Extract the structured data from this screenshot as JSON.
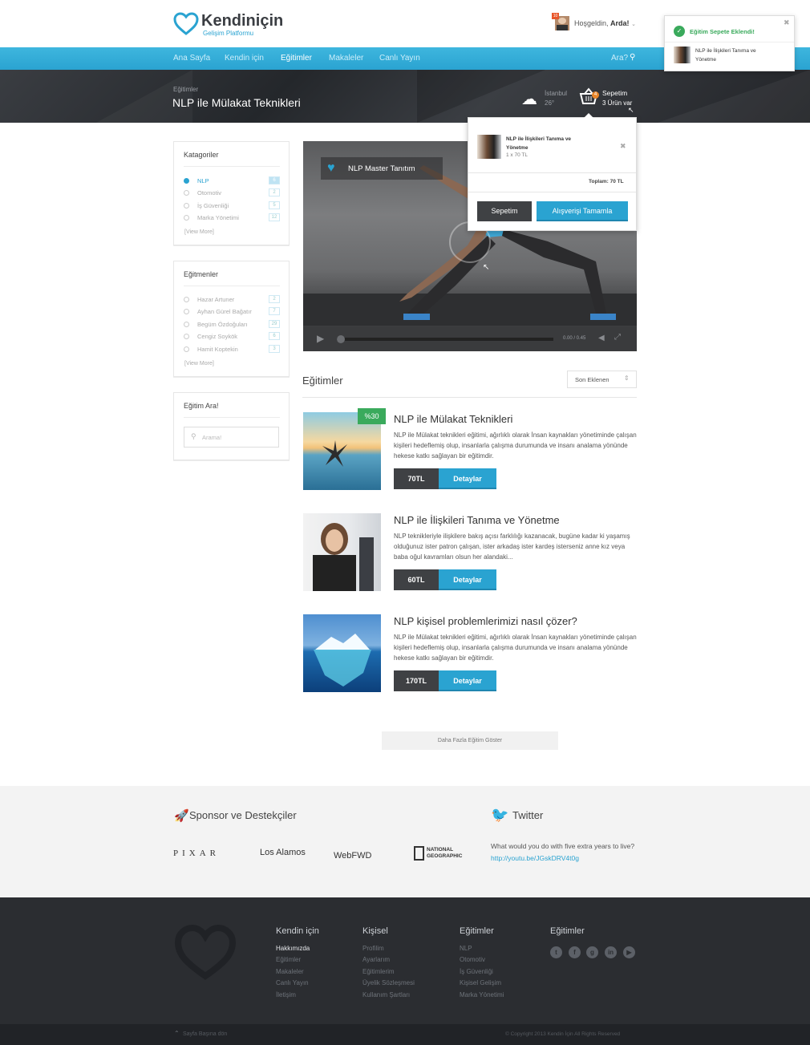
{
  "brand": {
    "name": "Kendiniçin",
    "tagline": "Gelişim Platformu"
  },
  "user": {
    "greeting": "Hoşgeldin,",
    "name": "Arda!",
    "notification_count": "10"
  },
  "nav": {
    "items": [
      "Ana Sayfa",
      "Kendin için",
      "Eğitimler",
      "Makaleler",
      "Canlı Yayın"
    ],
    "active": "Eğitimler",
    "search_label": "Ara?"
  },
  "hero": {
    "breadcrumb": "Eğitimler",
    "title": "NLP ile Mülakat Teknikleri",
    "weather_city": "İstanbul",
    "weather_temp": "26°",
    "cart_label": "Sepetim",
    "cart_count_text": "3 Ürün var",
    "cart_badge": "4"
  },
  "cart_popup": {
    "item_title": "NLP ile İlişkileri Tanıma ve Yönetme",
    "item_qty": "1 x 70 TL",
    "total": "Toplam: 70 TL",
    "cart_button": "Sepetim",
    "checkout_button": "Alışverişi Tamamla"
  },
  "toast": {
    "title": "Eğitim Sepete Eklendi!",
    "item_title": "NLP ile İlişkileri Tanıma ve Yönetme"
  },
  "sidebar": {
    "categories": {
      "title": "Katagoriler",
      "items": [
        {
          "label": "NLP",
          "count": "6"
        },
        {
          "label": "Otomotiv",
          "count": "2"
        },
        {
          "label": "İş Güvenliği",
          "count": "5"
        },
        {
          "label": "Marka Yönetimi",
          "count": "12"
        }
      ],
      "view_more": "[View More]"
    },
    "trainers": {
      "title": "Eğitmenler",
      "items": [
        {
          "label": "Hazar Artuner",
          "count": "2"
        },
        {
          "label": "Ayhan Gürel Bağatır",
          "count": "7"
        },
        {
          "label": "Begüm Özdoğuları",
          "count": "29"
        },
        {
          "label": "Cengiz Soykök",
          "count": "6"
        },
        {
          "label": "Hamit Koptekin",
          "count": "3"
        }
      ],
      "view_more": "[View More]"
    },
    "search": {
      "title": "Eğitim Ara!",
      "placeholder": "Arama!"
    }
  },
  "video": {
    "title": "NLP Master Tanıtım",
    "time": "0.00 / 0.45",
    "progress": 0.0
  },
  "list": {
    "heading": "Eğitimler",
    "sort": "Son Eklenen",
    "more_button": "Daha Fazla Eğitim Göster"
  },
  "courses": [
    {
      "title": "NLP ile Mülakat Teknikleri",
      "desc": "NLP ile Mülakat teknikleri eğitimi, ağırlıklı olarak İnsan kaynakları yönetiminde çalışan kişileri hedeflemiş olup, insanlarla çalışma durumunda ve insanı analama yönünde hekese katkı sağlayan bir eğitimdir.",
      "price": "70TL",
      "button": "Detaylar",
      "discount": "%30"
    },
    {
      "title": "NLP ile İlişkileri Tanıma ve Yönetme",
      "desc": "NLP teknikleriyle ilişkilere bakış açısı farklılığı kazanacak, bugüne kadar ki yaşamış olduğunuz ister patron çalışan, ister arkadaş ister kardeş isterseniz anne kız veya baba oğul kavramları olsun her alandaki...",
      "price": "60TL",
      "button": "Detaylar"
    },
    {
      "title": "NLP kişisel problemlerimizi nasıl çözer?",
      "desc": "NLP ile Mülakat teknikleri eğitimi, ağırlıklı olarak İnsan kaynakları yönetiminde çalışan kişileri hedeflemiş olup, insanlarla çalışma durumunda ve insanı analama yönünde hekese katkı sağlayan bir eğitimdir.",
      "price": "170TL",
      "button": "Detaylar"
    }
  ],
  "sponsors": {
    "title": "Sponsor ve Destekçiler",
    "logos": [
      "PIXAR",
      "Los Alamos",
      "WebFWD",
      "NATIONAL GEOGRAPHIC"
    ]
  },
  "twitter": {
    "title": "Twitter",
    "text": "What would you do with five extra years to live?",
    "link": "http://youtu.be/JGskDRV4t0g"
  },
  "footer": {
    "columns": [
      {
        "title": "Kendin için",
        "links": [
          "Hakkımızda",
          "Eğitimler",
          "Makaleler",
          "Canlı Yayın",
          "İletişim"
        ]
      },
      {
        "title": "Kişisel",
        "links": [
          "Profilim",
          "Ayarlarım",
          "Eğitimlerim",
          "Üyelik Sözleşmesi",
          "Kullanım Şartları"
        ]
      },
      {
        "title": "Eğitimler",
        "links": [
          "NLP",
          "Otomotiv",
          "İş Güvenliği",
          "Kişisel Gelişim",
          "Marka Yönetimi"
        ]
      }
    ],
    "social_title": "Eğitimler",
    "back_to_top": "Sayfa Başına dön",
    "copyright": "© Copyright 2013 Kendin İçin All Rights Reserved"
  },
  "colors": {
    "accent": "#2aa3d1",
    "dark": "#2b2d31",
    "green": "#3aaa5c"
  }
}
